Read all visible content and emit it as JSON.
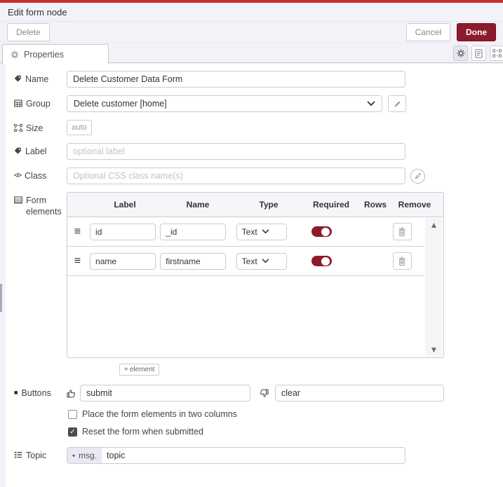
{
  "dialog": {
    "title": "Edit form node"
  },
  "toolbar": {
    "delete_label": "Delete",
    "cancel_label": "Cancel",
    "done_label": "Done"
  },
  "tabs": {
    "properties_label": "Properties"
  },
  "fields": {
    "name": {
      "label": "Name",
      "value": "Delete Customer Data Form"
    },
    "group": {
      "label": "Group",
      "value": "Delete customer [home]"
    },
    "size": {
      "label": "Size",
      "value": "auto"
    },
    "label": {
      "label": "Label",
      "placeholder": "optional label"
    },
    "class": {
      "label": "Class",
      "placeholder": "Optional CSS class name(s)"
    },
    "form_elements": {
      "label": "Form elements"
    },
    "buttons": {
      "label": "Buttons",
      "submit_value": "submit",
      "clear_value": "clear"
    },
    "topic": {
      "label": "Topic",
      "prefix": "msg.",
      "value": "topic"
    }
  },
  "elements_table": {
    "headers": {
      "label": "Label",
      "name": "Name",
      "type": "Type",
      "required": "Required",
      "rows": "Rows",
      "remove": "Remove"
    },
    "rows": [
      {
        "label": "id",
        "name": "_id",
        "type": "Text",
        "required": true
      },
      {
        "label": "name",
        "name": "firstname",
        "type": "Text",
        "required": true
      }
    ],
    "add_button_label": "element"
  },
  "checkboxes": [
    {
      "label": "Place the form elements in two columns",
      "checked": false
    },
    {
      "label": "Reset the form when submitted",
      "checked": true
    }
  ],
  "icons": {
    "drag": "≡",
    "scroll_up": "▲",
    "scroll_down": "▼",
    "caret_down": "▾",
    "square": "■",
    "code": "</>",
    "plus": "+",
    "check": "✓"
  },
  "colors": {
    "top_accent": "#c9302c",
    "done_bg": "#8c1b2b",
    "toggle_on": "#8c1b2b",
    "chrome_bg": "#f2f2f8",
    "table_header_bg": "#f6f6fa"
  }
}
